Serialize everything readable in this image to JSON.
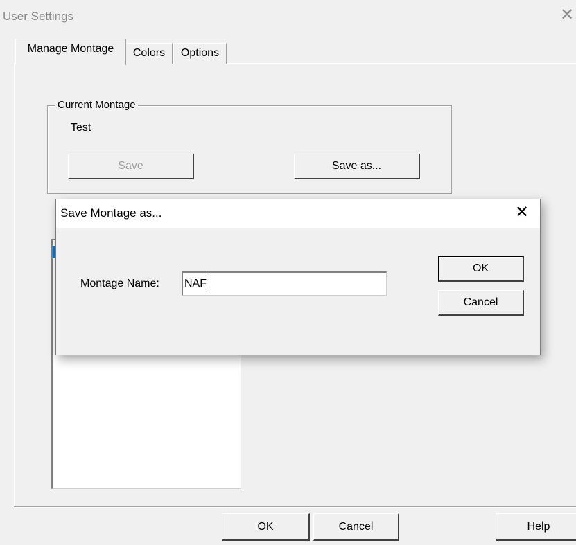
{
  "window": {
    "title": "User Settings",
    "close_glyph": "✕"
  },
  "tabs": [
    {
      "label": "Manage Montage",
      "selected": true
    },
    {
      "label": "Colors",
      "selected": false
    },
    {
      "label": "Options",
      "selected": false
    }
  ],
  "current_montage": {
    "group_label": "Current Montage",
    "value": "Test",
    "save_label": "Save",
    "save_as_label": "Save as..."
  },
  "footer": {
    "ok_label": "OK",
    "cancel_label": "Cancel",
    "help_label": "Help"
  },
  "dialog": {
    "title": "Save Montage as...",
    "close_glyph": "✕",
    "field_label": "Montage Name:",
    "field_value": "NAF",
    "ok_label": "OK",
    "cancel_label": "Cancel"
  },
  "colors": {
    "selection_blue": "#0078d7",
    "disabled_text": "#a0a0a0"
  }
}
